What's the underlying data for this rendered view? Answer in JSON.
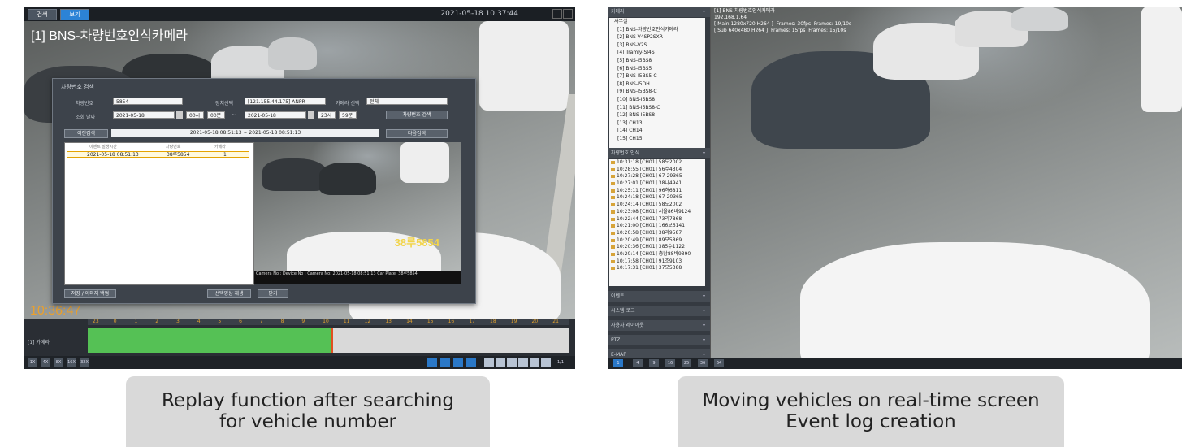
{
  "left_panel": {
    "top_buttons": [
      "검색",
      "보기"
    ],
    "camera_title": "[1] BNS-차량번호인식카메라",
    "datetime": "2021-05-18 10:37:44",
    "time_overlay": "10:36:47",
    "dialog": {
      "title": "차량번호 검색",
      "fields": {
        "plate_label": "차량번호",
        "plate_value": "5854",
        "device_label": "장치선택",
        "device_value": "[121.155.44.175] ANPR",
        "camera_label": "카메라 선택",
        "camera_value": "전체",
        "date_label": "조회 날짜",
        "date_from": "2021-05-18",
        "hour_from": "00시",
        "min_from": "00분",
        "date_sep": "~",
        "date_to": "2021-05-18",
        "hour_to": "23시",
        "min_to": "59분"
      },
      "search_button": "차량번호 검색",
      "prev_button": "이전검색",
      "next_button": "다음검색",
      "range_text": "2021-05-18 08:51:13 ~ 2021-05-18 08:51:13",
      "columns": [
        "이벤트 발생시간",
        "차량번호",
        "카메라"
      ],
      "row": {
        "time": "2021-05-18 08:51:13",
        "plate": "38루5854",
        "camera": "1"
      },
      "plate_overlay": "38루5854",
      "preview_caption": "Camera No : Device No : Camera No: 2021-05-18 08:51:13   Car Plate: 38루5854",
      "bottom_buttons": [
        "저장 / 이미지 백업",
        "선택영상 재생",
        "닫기"
      ]
    },
    "timeline": {
      "ruler": [
        "23",
        "0",
        "1",
        "2",
        "3",
        "4",
        "5",
        "6",
        "7",
        "8",
        "9",
        "10",
        "11",
        "12",
        "13",
        "14",
        "15",
        "16",
        "17",
        "18",
        "19",
        "20",
        "21"
      ],
      "row_label": "[1] 카메라",
      "speed_buttons": [
        "1X",
        "4X",
        "8X",
        "16X",
        "32X"
      ],
      "page": "1/1"
    }
  },
  "right_panel": {
    "sidebar": {
      "cameras_header": "카메라",
      "cameras": [
        "사무실",
        "[1] BNS-차량번호인식카메라",
        "[2] BNS-V4SP2SXR",
        "[3] BNS-V2S",
        "[4] Tramly-SI4S",
        "[5] BNS-I5BS8",
        "[6] BNS-I5BS5",
        "[7] BNS-I5BS5-C",
        "[8] BNS-I5DH",
        "[9] BNS-I5BS8-C",
        "[10] BNS-I5BS8",
        "[11] BNS-I5BS8-C",
        "[12] BNS-I5BS8",
        "[13] CH13",
        "[14] CH14",
        "[15] CH15"
      ],
      "events_header": "차량번호 인식",
      "events": [
        "10:31:18 [CH01] 58도2002",
        "10:28:55 [CH01] 56수4304",
        "10:27:28 [CH01] 67-29365",
        "10:27:01 [CH01] 38나4941",
        "10:25:11 [CH01] 96허6811",
        "10:24:18 [CH01] 67-20365",
        "10:24:14 [CH01] 58도2002",
        "10:23:08 [CH01] 서울86바9124",
        "10:22:44 [CH01] 73리7868",
        "10:21:00 [CH01] 166보6141",
        "10:20:58 [CH01] 38라9587",
        "10:20:49 [CH01] 89모5869",
        "10:20:36 [CH01] 385수1122",
        "10:20:14 [CH01] 충남88바9390",
        "10:17:58 [CH01] 91조9103",
        "10:17:31 [CH01] 37모5388"
      ],
      "other_headers": [
        "이벤트",
        "시스템 로그",
        "사용자 레이아웃",
        "PTZ",
        "E-MAP"
      ]
    },
    "overlay_lines": [
      "[1] BNS-차량번호인식카메라",
      "192.168.1.64",
      "[ Main 1280x720 H264 ]  Frames: 30fps  Frames: 19/10s",
      "[ Sub 640x480 H264 ]  Frames: 15fps  Frames: 15/10s"
    ],
    "layout_buttons": [
      "1",
      "4",
      "9",
      "16",
      "25",
      "36",
      "64"
    ]
  },
  "captions": {
    "left": [
      "Replay function after searching",
      "for vehicle number"
    ],
    "right": [
      "Moving vehicles on real-time screen",
      "Event log creation"
    ]
  }
}
